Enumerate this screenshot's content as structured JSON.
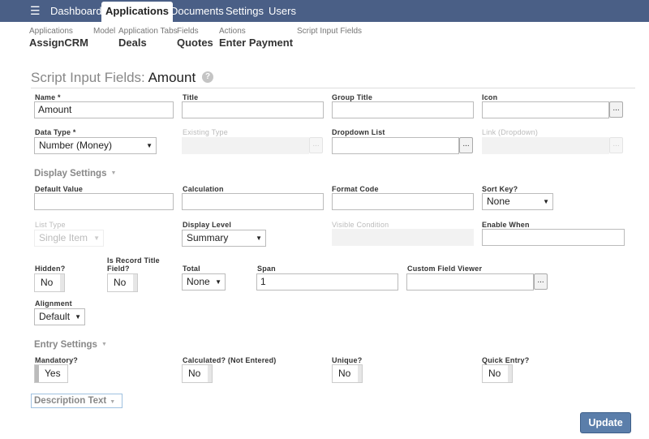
{
  "nav": {
    "items": [
      "Dashboard",
      "Applications",
      "Documents",
      "Settings",
      "Users"
    ],
    "active": "Applications"
  },
  "breadcrumb": [
    {
      "small": "Applications",
      "big": "AssignCRM"
    },
    {
      "small": "Model",
      "big": ""
    },
    {
      "small": "Application Tabs",
      "big": "Deals"
    },
    {
      "small": "Fields",
      "big": "Quotes"
    },
    {
      "small": "Actions",
      "big": "Enter Payment"
    },
    {
      "small": "Script Input Fields",
      "big": ""
    }
  ],
  "title": {
    "prefix": "Script Input Fields:",
    "name": "Amount",
    "help": "?"
  },
  "fields": {
    "name": {
      "label": "Name *",
      "value": "Amount"
    },
    "title": {
      "label": "Title",
      "value": ""
    },
    "group_title": {
      "label": "Group Title",
      "value": ""
    },
    "icon": {
      "label": "Icon",
      "value": ""
    },
    "data_type": {
      "label": "Data Type *",
      "value": "Number (Money)"
    },
    "existing_type": {
      "label": "Existing Type",
      "value": ""
    },
    "dropdown_list": {
      "label": "Dropdown List",
      "value": ""
    },
    "link_dropdown": {
      "label": "Link (Dropdown)",
      "value": ""
    },
    "default_value": {
      "label": "Default Value",
      "value": ""
    },
    "calculation": {
      "label": "Calculation",
      "value": ""
    },
    "format_code": {
      "label": "Format Code",
      "value": ""
    },
    "sort_key": {
      "label": "Sort Key?",
      "value": "None"
    },
    "list_type": {
      "label": "List Type",
      "value": "Single Item"
    },
    "display_level": {
      "label": "Display Level",
      "value": "Summary"
    },
    "visible_condition": {
      "label": "Visible Condition",
      "value": ""
    },
    "enable_when": {
      "label": "Enable When",
      "value": ""
    },
    "hidden": {
      "label": "Hidden?",
      "value": "No"
    },
    "is_record_title": {
      "label": "Is Record Title Field?",
      "value": "No"
    },
    "total": {
      "label": "Total",
      "value": "None"
    },
    "span": {
      "label": "Span",
      "value": "1"
    },
    "custom_field_viewer": {
      "label": "Custom Field Viewer",
      "value": ""
    },
    "alignment": {
      "label": "Alignment",
      "value": "Default"
    },
    "mandatory": {
      "label": "Mandatory?",
      "value": "Yes"
    },
    "calculated": {
      "label": "Calculated? (Not Entered)",
      "value": "No"
    },
    "unique": {
      "label": "Unique?",
      "value": "No"
    },
    "quick_entry": {
      "label": "Quick Entry?",
      "value": "No"
    }
  },
  "sections": {
    "display_settings": "Display Settings",
    "entry_settings": "Entry Settings",
    "description_text": "Description Text"
  },
  "buttons": {
    "ellipsis": "...",
    "update": "Update"
  },
  "icons": {
    "menu": "hamburger-icon",
    "caret": "▼",
    "collapse": "▼"
  }
}
